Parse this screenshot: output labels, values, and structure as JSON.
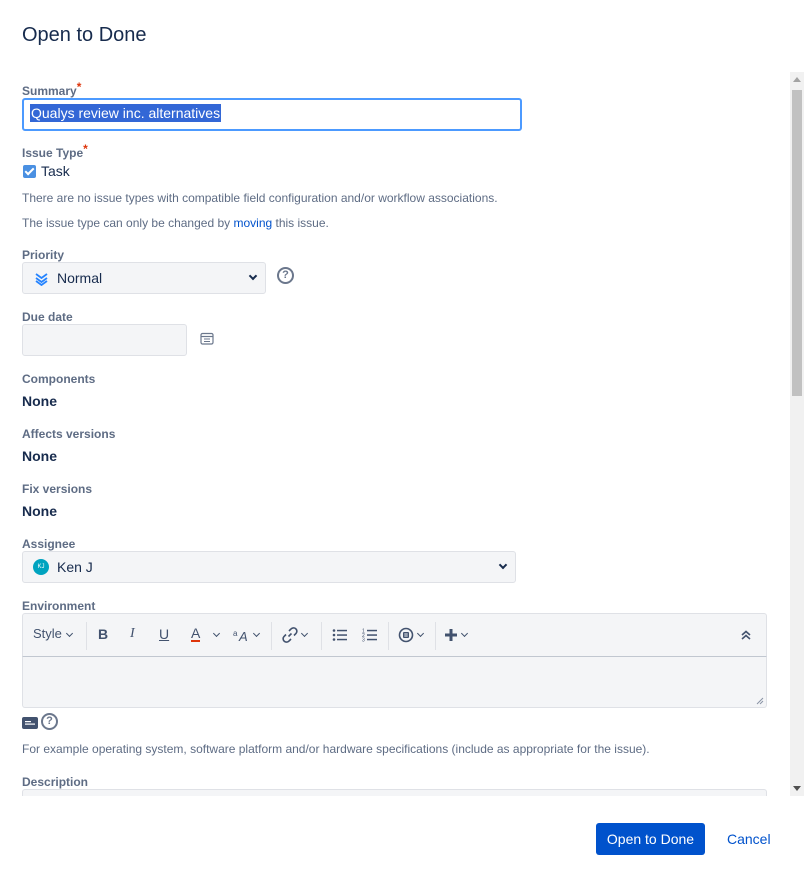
{
  "dialog": {
    "title": "Open to Done"
  },
  "fields": {
    "summary": {
      "label": "Summary",
      "required_mark": "*",
      "value": "Qualys review inc. alternatives"
    },
    "issue_type": {
      "label": "Issue Type",
      "required_mark": "*",
      "value": "Task",
      "note1": "There are no issue types with compatible field configuration and/or workflow associations.",
      "note2_prefix": "The issue type can only be changed by ",
      "note2_link": "moving",
      "note2_suffix": " this issue."
    },
    "priority": {
      "label": "Priority",
      "value": "Normal"
    },
    "due_date": {
      "label": "Due date",
      "value": ""
    },
    "components": {
      "label": "Components",
      "value": "None"
    },
    "affects_versions": {
      "label": "Affects versions",
      "value": "None"
    },
    "fix_versions": {
      "label": "Fix versions",
      "value": "None"
    },
    "assignee": {
      "label": "Assignee",
      "value": "Ken J",
      "avatar_initials": "KJ"
    },
    "environment": {
      "label": "Environment",
      "toolbar": {
        "style_label": "Style",
        "bold": "B",
        "italic": "I",
        "underline": "U",
        "color": "A"
      },
      "hint": "For example operating system, software platform and/or hardware specifications (include as appropriate for the issue)."
    },
    "description": {
      "label": "Description"
    }
  },
  "footer": {
    "submit_label": "Open to Done",
    "cancel_label": "Cancel"
  },
  "colors": {
    "primary": "#0052cc",
    "focus": "#4c9aff",
    "required": "#de350b",
    "text_color_red": "#de350b"
  }
}
